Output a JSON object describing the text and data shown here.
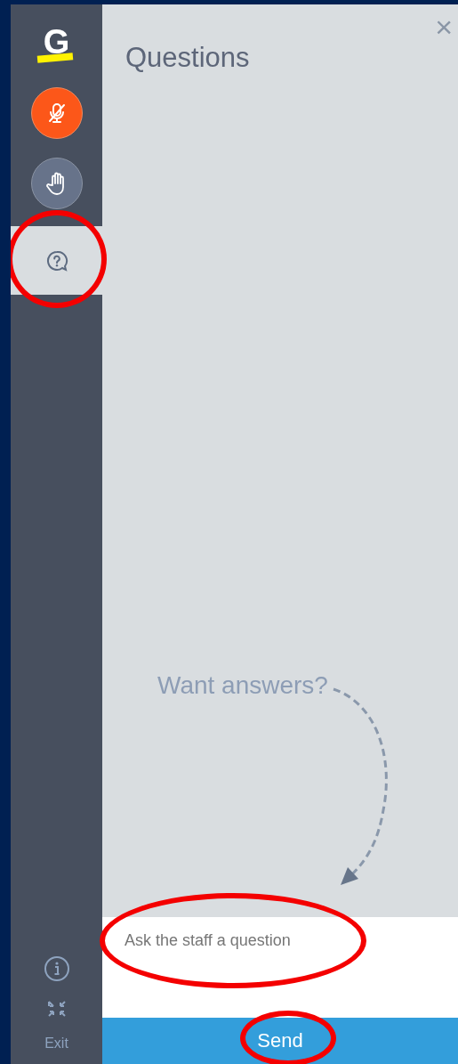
{
  "sidebar": {
    "logo": "G",
    "tools": [
      {
        "kind": "mic",
        "muted": true
      },
      {
        "kind": "hand",
        "muted": false
      },
      {
        "kind": "questions",
        "selected": true,
        "circled": true
      }
    ],
    "bottom": [
      {
        "kind": "info"
      },
      {
        "kind": "expand"
      }
    ],
    "exit": "Exit"
  },
  "panel": {
    "title": "Questions",
    "close": "×",
    "hint": "Want answers?",
    "input": {
      "placeholder": "Ask the staff a question",
      "circled": true
    },
    "send": {
      "label": "Send",
      "circled": true
    }
  }
}
